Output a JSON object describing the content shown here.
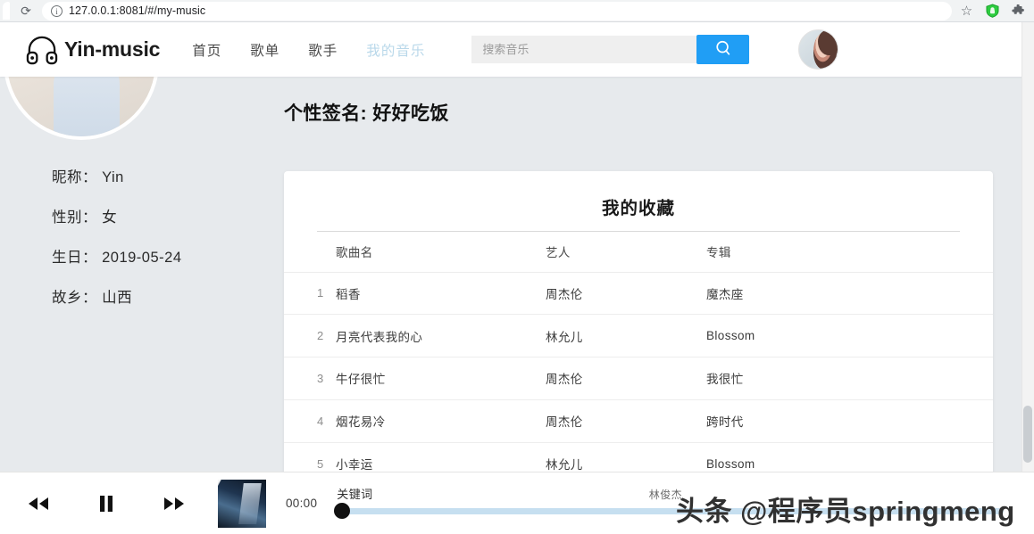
{
  "browser": {
    "url": "127.0.0.1:8081/#/my-music",
    "info_icon": "info-circle-icon",
    "reload_icon": "reload-icon",
    "star_icon": "bookmark-star-icon",
    "shield_icon": "shield-icon",
    "extensions_icon": "puzzle-piece-icon"
  },
  "header": {
    "logo_text": "Yin-music",
    "logo_icon": "headphones-icon",
    "nav": [
      {
        "label": "首页",
        "active": false
      },
      {
        "label": "歌单",
        "active": false
      },
      {
        "label": "歌手",
        "active": false
      },
      {
        "label": "我的音乐",
        "active": true
      }
    ],
    "search": {
      "placeholder": "搜索音乐",
      "value": "",
      "button_icon": "search-icon"
    },
    "avatar": "user-avatar"
  },
  "profile": {
    "signature_text": "个性签名: 好好吃饭",
    "avatar": "profile-avatar-large",
    "fields": [
      {
        "label": "昵称：",
        "value": "Yin"
      },
      {
        "label": "性别：",
        "value": "女"
      },
      {
        "label": "生日：",
        "value": "2019-05-24"
      },
      {
        "label": "故乡：",
        "value": "山西"
      }
    ]
  },
  "collection": {
    "title": "我的收藏",
    "columns": {
      "index": "",
      "song": "歌曲名",
      "artist": "艺人",
      "album": "专辑"
    },
    "rows": [
      {
        "index": "1",
        "song": "稻香",
        "artist": "周杰伦",
        "album": "魔杰座"
      },
      {
        "index": "2",
        "song": "月亮代表我的心",
        "artist": "林允儿",
        "album": "Blossom"
      },
      {
        "index": "3",
        "song": "牛仔很忙",
        "artist": "周杰伦",
        "album": "我很忙"
      },
      {
        "index": "4",
        "song": "烟花易冷",
        "artist": "周杰伦",
        "album": "跨时代"
      },
      {
        "index": "5",
        "song": "小幸运",
        "artist": "林允儿",
        "album": "Blossom"
      }
    ]
  },
  "player": {
    "prev_icon": "rewind-icon",
    "play_icon": "pause-icon",
    "next_icon": "fast-forward-icon",
    "cover": "album-cover",
    "current_time": "00:00",
    "track_title": "关键词",
    "track_artist": "林俊杰",
    "progress_percent": 0
  },
  "watermark": {
    "text": "头条 @程序员springmeng"
  },
  "colors": {
    "page_bg": "#e7eaed",
    "accent_blue": "#209ef5",
    "nav_active": "#b9d8ea",
    "slider_track": "#c6dff0"
  }
}
